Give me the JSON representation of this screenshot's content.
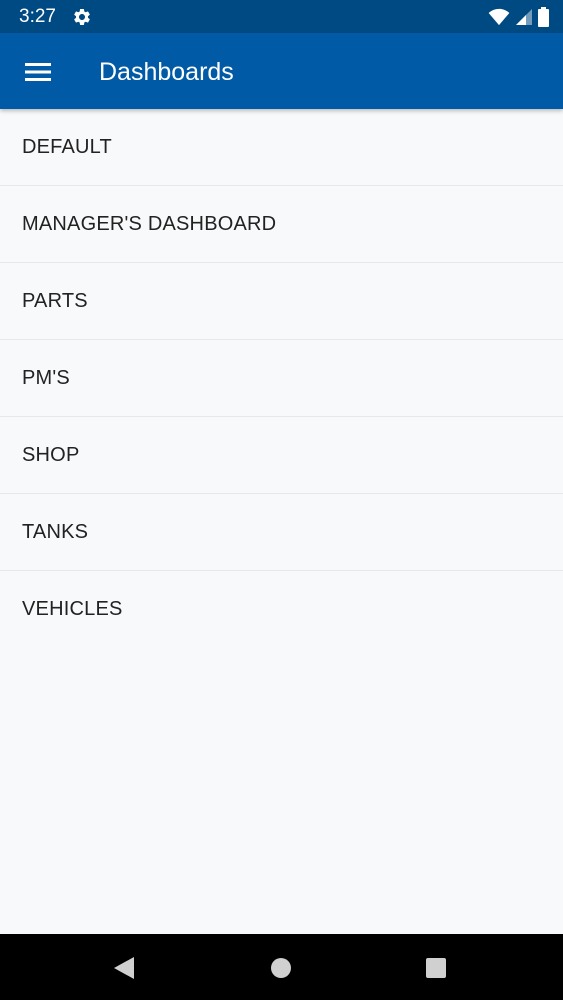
{
  "status_bar": {
    "time": "3:27",
    "icons": [
      "gear-icon",
      "wifi-icon",
      "signal-icon",
      "battery-icon"
    ]
  },
  "app_bar": {
    "title": "Dashboards",
    "menu_icon": "hamburger-menu-icon",
    "color": "#005aa6"
  },
  "dashboards": [
    {
      "label": "DEFAULT"
    },
    {
      "label": "MANAGER'S DASHBOARD"
    },
    {
      "label": "PARTS"
    },
    {
      "label": "PM'S"
    },
    {
      "label": "SHOP"
    },
    {
      "label": "TANKS"
    },
    {
      "label": "VEHICLES"
    }
  ],
  "nav_bar": {
    "buttons": [
      "back-icon",
      "home-icon",
      "recents-icon"
    ]
  }
}
